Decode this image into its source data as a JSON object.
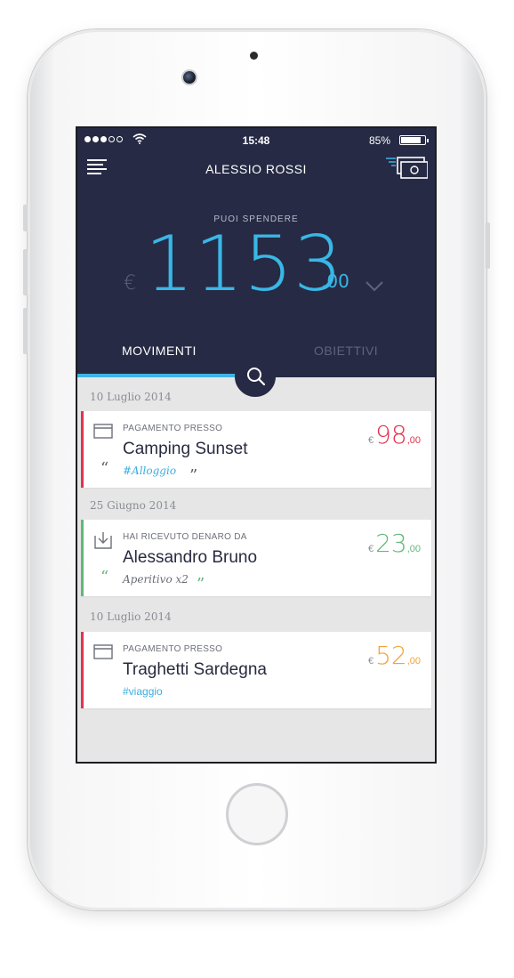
{
  "status_bar": {
    "time": "15:48",
    "battery": "85%"
  },
  "header": {
    "user_name": "ALESSIO ROSSI"
  },
  "balance": {
    "label": "PUOI SPENDERE",
    "currency": "€",
    "integer": "1153",
    "decimal": ",00"
  },
  "tabs": [
    {
      "label": "MOVIMENTI",
      "active": true
    },
    {
      "label": "OBIETTIVI",
      "active": false
    }
  ],
  "transactions": [
    {
      "date": "10 Luglio 2014",
      "kicker": "PAGAMENTO PRESSO",
      "title": "Camping Sunset",
      "tag": "#Alloggio",
      "currency": "€",
      "amount": "98",
      "cents": ",00",
      "color": "#e0344f",
      "icon": "card-icon"
    },
    {
      "date": "25 Giugno 2014",
      "kicker": "HAI RICEVUTO DENARO DA",
      "title": "Alessandro Bruno",
      "tag": "Aperitivo x2",
      "currency": "€",
      "amount": "23",
      "cents": ",00",
      "color": "#5fb976",
      "icon": "download-icon"
    },
    {
      "date": "10 Luglio 2014",
      "kicker": "PAGAMENTO PRESSO",
      "title": "Traghetti Sardegna",
      "tag": "#viaggio",
      "currency": "€",
      "amount": "52",
      "cents": ",00",
      "color": "#f3a33a",
      "icon": "card-icon"
    }
  ],
  "colors": {
    "header_bg": "#262a44",
    "accent": "#39b7e6",
    "debit": "#e0344f",
    "credit": "#5fb976",
    "warning": "#f3a33a"
  }
}
